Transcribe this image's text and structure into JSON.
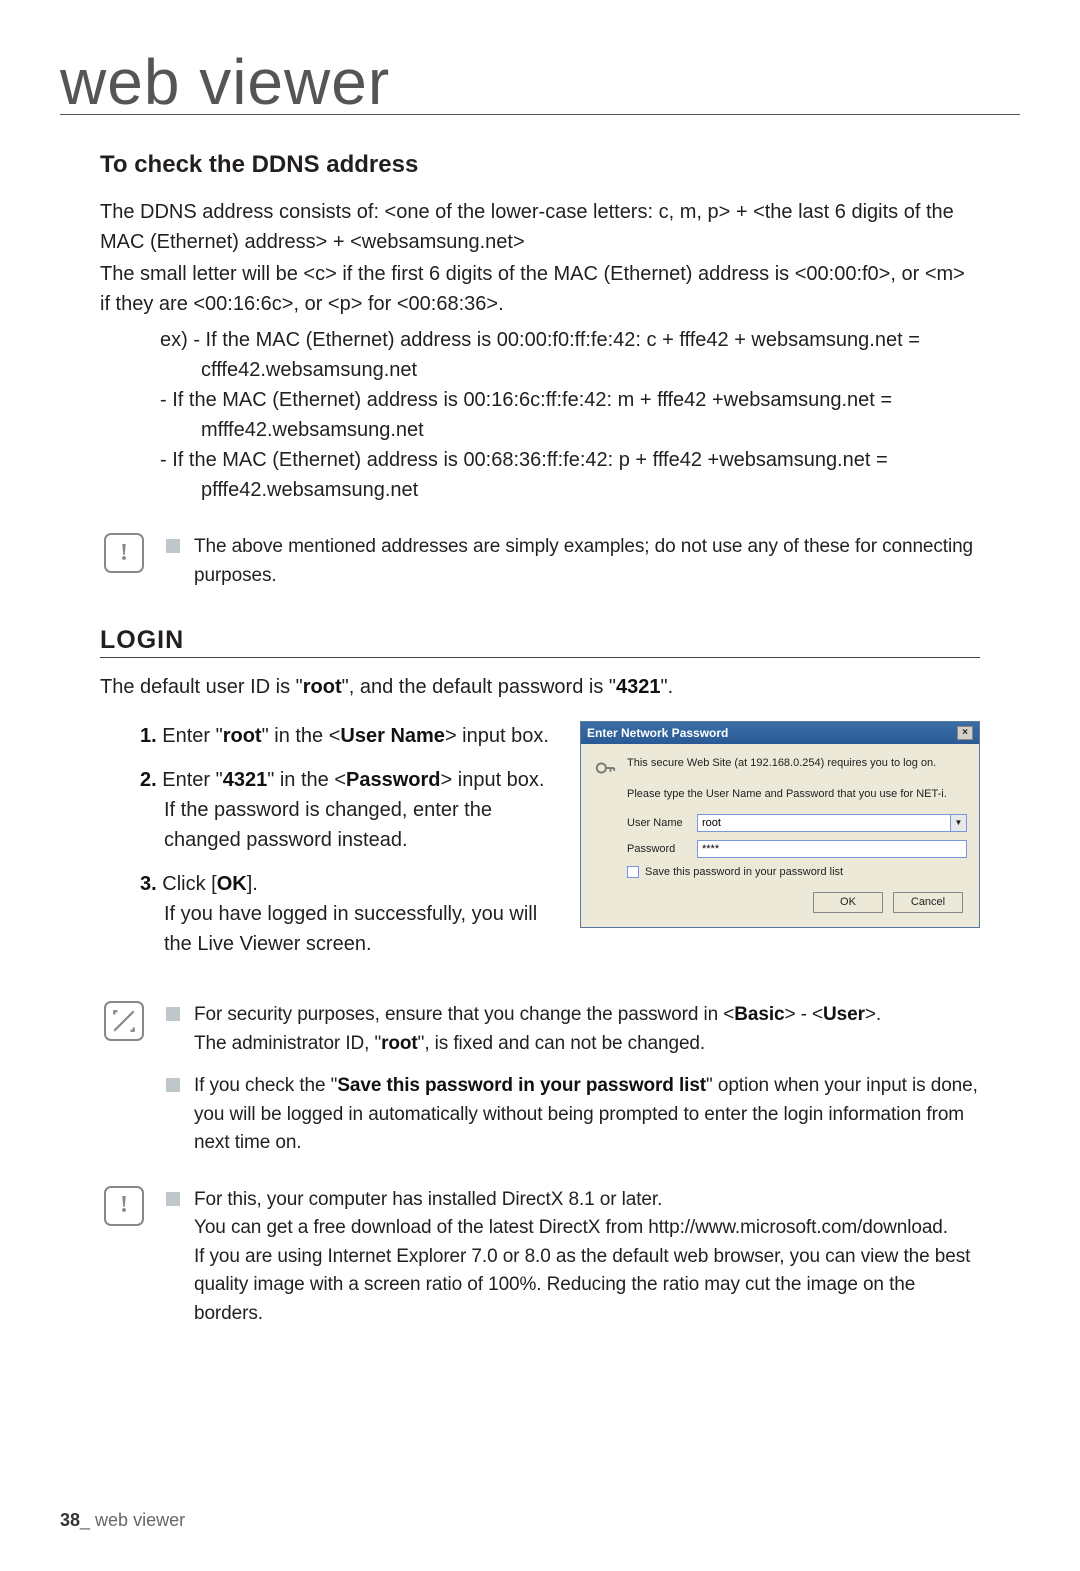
{
  "page_title": "web viewer",
  "section1_heading": "To check the DDNS address",
  "p1": "The DDNS address consists of: <one of the lower-case letters: c, m, p> + <the last 6 digits of the MAC (Ethernet) address> + <websamsung.net>",
  "p2": "The small letter will be <c> if the first 6 digits of the MAC (Ethernet) address is <00:00:f0>, or <m> if they are <00:16:6c>, or <p> for <00:68:36>.",
  "ex_label": "ex) ",
  "ex1a": "- If the MAC (Ethernet) address is 00:00:f0:ff:fe:42: c + fffe42 + websamsung.net = cfffe42.websamsung.net",
  "ex2a": "- If the MAC (Ethernet) address is 00:16:6c:ff:fe:42: m + fffe42 +websamsung.net = mfffe42.websamsung.net",
  "ex3a": "- If the MAC (Ethernet) address is 00:68:36:ff:fe:42: p + fffe42 +websamsung.net = pfffe42.websamsung.net",
  "caution1": "The above mentioned addresses are simply examples; do not use any of these for connecting purposes.",
  "section2_heading": "LOGIN",
  "login_intro_1": "The default user ID is \"",
  "login_intro_root": "root",
  "login_intro_2": "\", and the default password is \"",
  "login_intro_pass": "4321",
  "login_intro_3": "\".",
  "step1_pre": "1.",
  "step1_a": " Enter \"",
  "step1_root": "root",
  "step1_b": "\" in the <",
  "step1_field": "User Name",
  "step1_c": "> input box.",
  "step2_pre": "2.",
  "step2_a": " Enter \"",
  "step2_val": "4321",
  "step2_b": "\" in the <",
  "step2_field": "Password",
  "step2_c": "> input box.",
  "step2_note": "If the password is changed, enter the changed password instead.",
  "step3_pre": "3.",
  "step3_a": " Click [",
  "step3_ok": "OK",
  "step3_b": "].",
  "step3_note": "If you have logged in successfully, you will the Live Viewer screen.",
  "dialog": {
    "title": "Enter Network Password",
    "msg1": "This secure Web Site (at 192.168.0.254) requires you to log on.",
    "msg2": "Please type the User Name and Password that you use for NET-i.",
    "user_label": "User Name",
    "user_value": "root",
    "pass_label": "Password",
    "pass_value": "****",
    "save_label": "Save this password in your password list",
    "ok": "OK",
    "cancel": "Cancel"
  },
  "note2a_1": "For security purposes, ensure that you change the password in <",
  "note2a_basic": "Basic",
  "note2a_2": "> - <",
  "note2a_user": "User",
  "note2a_3": ">.",
  "note2a_line2a": "The administrator ID, \"",
  "note2a_line2_root": "root",
  "note2a_line2b": "\", is fixed and can not be changed.",
  "note2b_1": "If you check the \"",
  "note2b_bold": "Save this password in your password list",
  "note2b_2": "\" option when your input is done, you will be logged in automatically without being prompted to enter the login information from next time on.",
  "caution2_l1": "For this, your computer has installed DirectX 8.1 or later.",
  "caution2_l2": "You can get a free download of the latest DirectX from http://www.microsoft.com/download.",
  "caution2_l3": "If you are using Internet Explorer 7.0 or 8.0 as the default web browser, you can view the best quality image with a screen ratio of 100%. Reducing the ratio may cut the image on the borders.",
  "footer_pagenum": "38",
  "footer_label": "_ web viewer"
}
